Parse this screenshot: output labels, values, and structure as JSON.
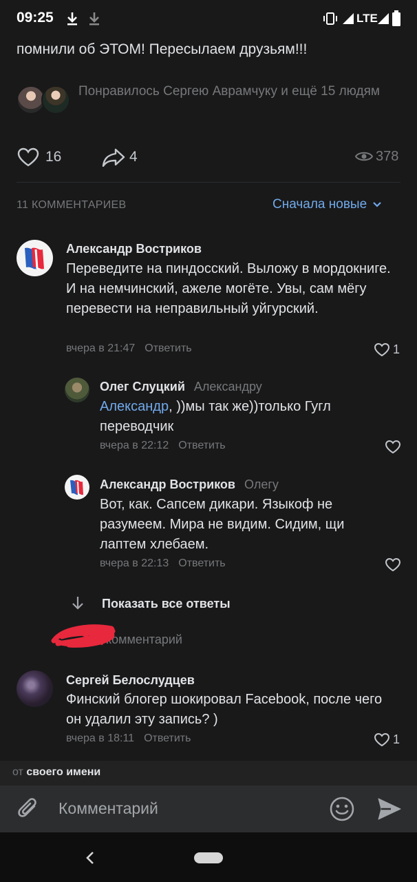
{
  "status_bar": {
    "time": "09:25",
    "network": "LTE",
    "icons": [
      "download-icon",
      "download-icon",
      "vibrate-icon",
      "signal-icon",
      "signal-icon",
      "battery-icon"
    ]
  },
  "post": {
    "text_tail": "помнили об ЭТОМ! Пересылаем друзьям!!!",
    "liked_by": "Понравилось Сергею Аврамчуку и ещё 15 людям",
    "likes": "16",
    "shares": "4",
    "views": "378"
  },
  "comments_header": {
    "count_label": "11 КОММЕНТАРИЕВ",
    "sort_label": "Сначала новые"
  },
  "comments": [
    {
      "author": "Александр Востриков",
      "text": "Переведите на пиндосский. Выложу в мордокниге. И на немчинский, ажеле могёте. Увы, сам мёгу перевести на неправильный уйгурский.",
      "time": "вчера в 21:47",
      "reply_label": "Ответить",
      "likes": "1"
    },
    {
      "author": "Олег Слуцкий",
      "reply_to": "Александру",
      "mention": "Александр",
      "text": ", ))мы так же))только Гугл переводчик",
      "time": "вчера в 22:12",
      "reply_label": "Ответить"
    },
    {
      "author": "Александр Востриков",
      "reply_to": "Олегу",
      "text": "Вот, как. Сапсем дикари. Языкоф не разумеем. Мира не видим. Сидим, щи лаптем хлебаем.",
      "time": "вчера в 22:13",
      "reply_label": "Ответить"
    },
    {
      "author": "Сергей Белослудцев",
      "text": "Финский блогер шокировал Facebook, после чего он удалил эту запись? )",
      "time": "вчера в 18:11",
      "reply_label": "Ответить",
      "likes": "1"
    }
  ],
  "show_all_label": "Показать все ответы",
  "hidden_comment_label": "комментарий",
  "composer": {
    "from_prefix": "от",
    "from_name": "своего имени",
    "placeholder": "Комментарий"
  },
  "colors": {
    "background": "#19191a",
    "accent": "#71aaeb",
    "secondary_text": "#76787a",
    "scribble": "#e8283c"
  }
}
